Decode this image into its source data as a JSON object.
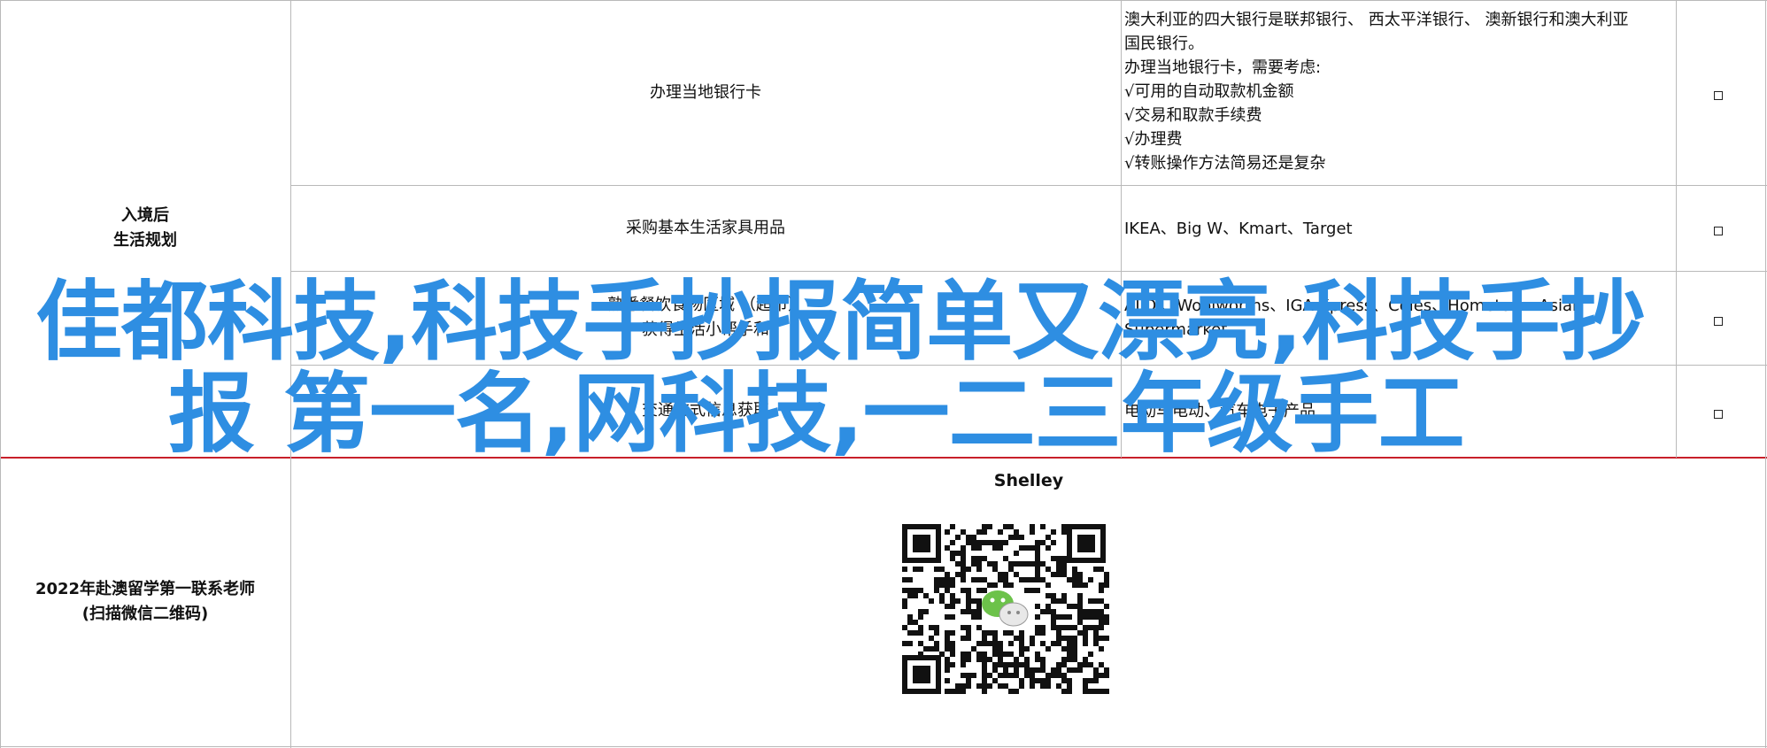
{
  "table": {
    "rows": [
      {
        "item": "办理当地银行卡",
        "details": [
          "澳大利亚的四大银行是联邦银行、 西太平洋银行、 澳新银行和澳大利亚",
          "国民银行。",
          "办理当地银行卡，需要考虑:",
          "√可用的自动取款机金额",
          "√交易和取款手续费",
          "√办理费",
          "√转账操作方法简易还是复杂"
        ]
      },
      {
        "item": "采购基本生活家具用品",
        "details": [
          "IKEA、Big W、Kmart、Target"
        ]
      },
      {
        "item": "熟悉餐饮食物区域 （超市）",
        "item2": "获得生活小帮手和",
        "details": [
          "ALDI、Woolworths、IGA Xpress、Coles、Hometown Asian",
          "Supermarket"
        ]
      },
      {
        "item": "交通方式信息获取",
        "details": [
          "电动车电动、汽车电子产品"
        ]
      }
    ],
    "category_after_arrival": [
      "入境后",
      "生活规划"
    ],
    "contact": {
      "category": [
        "2022年赴澳留学第一联系老师",
        "(扫描微信二维码)"
      ],
      "name": "Shelley",
      "qr_icon": "wechat-qr-code"
    }
  },
  "overlay": {
    "line1": "佳都科技,科技手抄报简单又漂亮,科技手抄",
    "line2": "报 第一名,网科技,一二三年级手工"
  },
  "colors": {
    "overlay": "#2e8ee2",
    "red_rule": "#c8202a",
    "grid": "#b9b9b9"
  }
}
